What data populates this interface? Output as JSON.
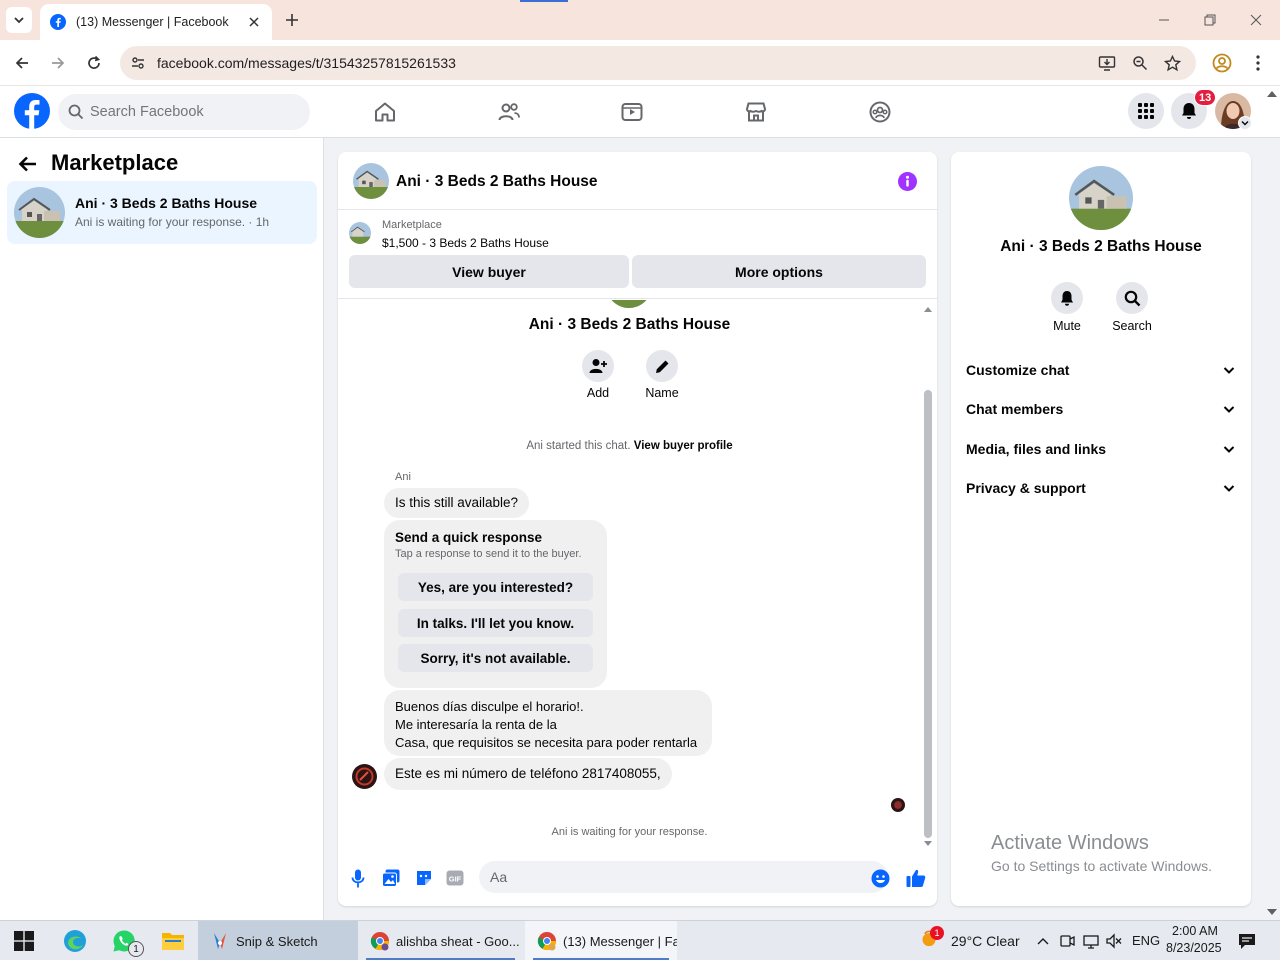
{
  "browser": {
    "tab_title": "(13) Messenger | Facebook",
    "url": "facebook.com/messages/t/31543257815261533"
  },
  "fb": {
    "search_placeholder": "Search Facebook",
    "notification_count": "13"
  },
  "left_panel": {
    "title": "Marketplace",
    "conversation": {
      "name": "Ani · 3 Beds 2 Baths House",
      "status": "Ani is waiting for your response. · 1h"
    }
  },
  "chat": {
    "header_name": "Ani · 3 Beds 2 Baths House",
    "listing_category": "Marketplace",
    "listing_price": "$1,500 - 3 Beds 2 Baths House",
    "view_buyer": "View buyer",
    "more_options": "More options",
    "thread_name": "Ani · 3 Beds 2 Baths House",
    "add_label": "Add",
    "name_label": "Name",
    "started_text": "Ani started this chat.",
    "view_buyer_profile": "View buyer profile",
    "sender": "Ani",
    "msg_available": "Is this still available?",
    "quick_title": "Send a quick response",
    "quick_sub": "Tap a response to send it to the buyer.",
    "quick_responses": [
      "Yes, are you interested?",
      "In talks. I'll let you know.",
      "Sorry, it's not available."
    ],
    "msg_lines": [
      "Buenos días disculpe el horario!.",
      "Me interesaría la renta de la",
      "Casa, que requisitos se necesita para poder rentarla"
    ],
    "msg_phone": "Este es mi número de teléfono 2817408055,",
    "waiting": "Ani is waiting for your response.",
    "composer_placeholder": "Aa"
  },
  "right_panel": {
    "name": "Ani · 3 Beds 2 Baths House",
    "mute": "Mute",
    "search": "Search",
    "sections": [
      "Customize chat",
      "Chat members",
      "Media, files and links",
      "Privacy & support"
    ]
  },
  "watermark": {
    "title": "Activate Windows",
    "sub": "Go to Settings to activate Windows."
  },
  "taskbar": {
    "apps": [
      "Snip & Sketch",
      "alishba sheat - Goo...",
      "(13) Messenger | Fa..."
    ],
    "whatsapp_badge": "1",
    "weather_badge": "1",
    "weather": "29°C  Clear",
    "lang": "ENG",
    "time": "2:00 AM",
    "date": "8/23/2025"
  },
  "colors": {
    "fb_blue": "#0866ff",
    "messenger_purple": "#a033ff",
    "selected_bg": "#ebf5ff",
    "badge_red": "#e41e3f"
  }
}
